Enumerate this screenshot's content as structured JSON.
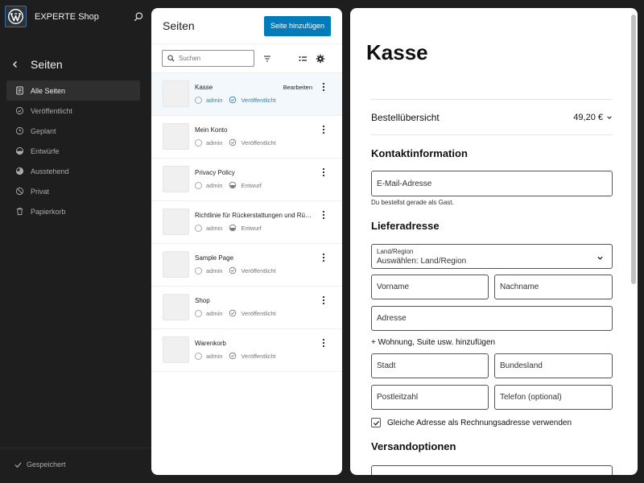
{
  "colors": {
    "accent": "#007cba",
    "sidebar_bg": "#1e1e1e",
    "selected_row": "#f2f8fb"
  },
  "site": {
    "title": "EXPERTE Shop",
    "logo_icon": "wordpress-icon"
  },
  "sidebar": {
    "heading": "Seiten",
    "items": [
      {
        "label": "Alle Seiten",
        "icon": "pages-icon",
        "active": true
      },
      {
        "label": "Veröffentlicht",
        "icon": "published-icon"
      },
      {
        "label": "Geplant",
        "icon": "scheduled-icon"
      },
      {
        "label": "Entwürfe",
        "icon": "drafts-icon"
      },
      {
        "label": "Ausstehend",
        "icon": "pending-icon"
      },
      {
        "label": "Privat",
        "icon": "private-icon"
      },
      {
        "label": "Papierkorb",
        "icon": "trash-icon"
      }
    ],
    "saved_label": "Gespeichert"
  },
  "pages_panel": {
    "title": "Seiten",
    "add_button": "Seite hinzufügen",
    "search_placeholder": "Suchen",
    "edit_label": "Bearbeiten",
    "rows": [
      {
        "title": "Kasse",
        "author": "admin",
        "status": "Veröffentlicht"
      },
      {
        "title": "Mein Konto",
        "author": "admin",
        "status": "Veröffentlicht"
      },
      {
        "title": "Privacy Policy",
        "author": "admin",
        "status": "Entwurf"
      },
      {
        "title": "Richtlinie für Rückerstattungen und Rü…",
        "author": "admin",
        "status": "Entwurf"
      },
      {
        "title": "Sample Page",
        "author": "admin",
        "status": "Veröffentlicht"
      },
      {
        "title": "Shop",
        "author": "admin",
        "status": "Veröffentlicht"
      },
      {
        "title": "Warenkorb",
        "author": "admin",
        "status": "Veröffentlicht"
      }
    ]
  },
  "preview": {
    "page_title": "Kasse",
    "order_summary_label": "Bestellübersicht",
    "order_total": "49,20 €",
    "contact_heading": "Kontaktinformation",
    "email_placeholder": "E-Mail-Adresse",
    "guest_hint": "Du bestellst gerade als Gast.",
    "shipping_heading": "Lieferadresse",
    "country_label": "Land/Region",
    "country_value": "Auswählen: Land/Region",
    "first_name": "Vorname",
    "last_name": "Nachname",
    "address": "Adresse",
    "add_apartment": "+ Wohnung, Suite usw. hinzufügen",
    "city": "Stadt",
    "state": "Bundesland",
    "postcode": "Postleitzahl",
    "phone": "Telefon (optional)",
    "same_address_label": "Gleiche Adresse als Rechnungsadresse verwenden",
    "same_address_checked": true,
    "shipping_options_heading": "Versandoptionen"
  }
}
